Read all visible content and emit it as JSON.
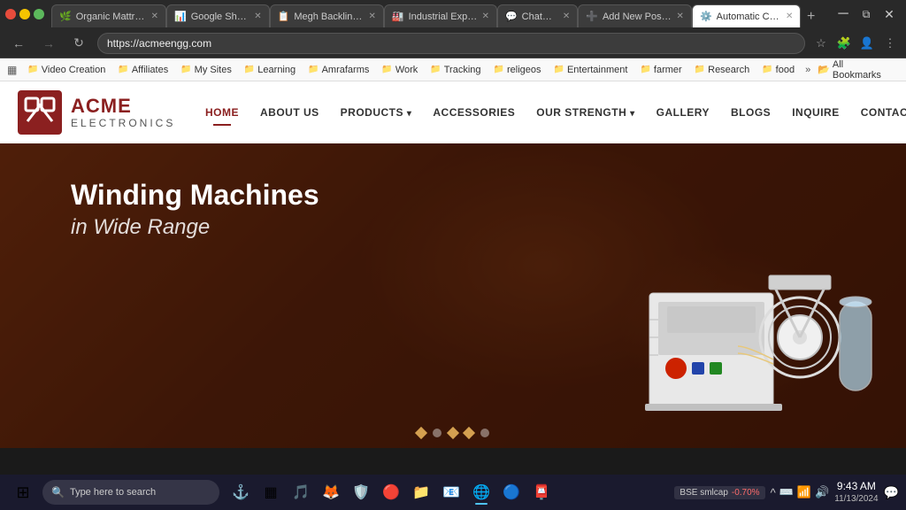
{
  "browser": {
    "title": "Automatic Coil",
    "tabs": [
      {
        "id": "t1",
        "favicon": "🌿",
        "label": "Organic Mattres...",
        "active": false
      },
      {
        "id": "t2",
        "favicon": "📊",
        "label": "Google Sheets",
        "active": false
      },
      {
        "id": "t3",
        "favicon": "📋",
        "label": "Megh Backlinks...",
        "active": false
      },
      {
        "id": "t4",
        "favicon": "🏭",
        "label": "Industrial Exper...",
        "active": false
      },
      {
        "id": "t5",
        "favicon": "💬",
        "label": "ChatGPT",
        "active": false
      },
      {
        "id": "t6",
        "favicon": "➕",
        "label": "Add New Post -...",
        "active": false
      },
      {
        "id": "t7",
        "favicon": "🔧",
        "label": "Automatic Coil...",
        "active": true
      }
    ],
    "address": "https://acmeengg.com",
    "bookmarks": [
      {
        "icon": "🎬",
        "label": "Video Creation"
      },
      {
        "icon": "🔗",
        "label": "Affiliates"
      },
      {
        "icon": "🌐",
        "label": "My Sites"
      },
      {
        "icon": "📚",
        "label": "Learning"
      },
      {
        "icon": "🌾",
        "label": "Amrafarms"
      },
      {
        "icon": "💼",
        "label": "Work"
      },
      {
        "icon": "📍",
        "label": "Tracking"
      },
      {
        "icon": "🙏",
        "label": "religeos"
      },
      {
        "icon": "🎭",
        "label": "Entertainment"
      },
      {
        "icon": "👨‍🌾",
        "label": "farmer"
      },
      {
        "icon": "🔬",
        "label": "Research"
      },
      {
        "icon": "🍽️",
        "label": "food"
      }
    ],
    "all_bookmarks": "All Bookmarks"
  },
  "website": {
    "logo": {
      "name": "ACME",
      "sub": "ELECTRONICS"
    },
    "nav": [
      {
        "label": "HOME",
        "active": true,
        "has_arrow": false
      },
      {
        "label": "ABOUT US",
        "active": false,
        "has_arrow": false
      },
      {
        "label": "PRODUCTS",
        "active": false,
        "has_arrow": true
      },
      {
        "label": "ACCESSORIES",
        "active": false,
        "has_arrow": false
      },
      {
        "label": "OUR STRENGTH",
        "active": false,
        "has_arrow": true
      },
      {
        "label": "GALLERY",
        "active": false,
        "has_arrow": false
      },
      {
        "label": "BLOGS",
        "active": false,
        "has_arrow": false
      },
      {
        "label": "INQUIRE",
        "active": false,
        "has_arrow": false
      },
      {
        "label": "CONTACT US",
        "active": false,
        "has_arrow": false
      }
    ],
    "hero": {
      "title": "Winding Machines",
      "subtitle": "in Wide Range"
    },
    "carousel": {
      "dots": [
        {
          "type": "diamond",
          "active": true
        },
        {
          "type": "circle",
          "active": false
        },
        {
          "type": "diamond",
          "active": true
        },
        {
          "type": "diamond",
          "active": true
        },
        {
          "type": "diamond",
          "active": false
        }
      ]
    }
  },
  "taskbar": {
    "search_placeholder": "Type here to search",
    "apps": [
      {
        "icon": "⊞",
        "name": "windows-icon"
      },
      {
        "icon": "🔍",
        "name": "search-icon"
      },
      {
        "icon": "⚓",
        "name": "ship-icon"
      },
      {
        "icon": "▦",
        "name": "grid-icon"
      },
      {
        "icon": "🎵",
        "name": "spotify-icon"
      },
      {
        "icon": "🦊",
        "name": "firefox-icon"
      },
      {
        "icon": "🛡️",
        "name": "brave-icon"
      },
      {
        "icon": "🔴",
        "name": "opera-icon"
      },
      {
        "icon": "📁",
        "name": "files-icon"
      },
      {
        "icon": "📧",
        "name": "mail-icon"
      },
      {
        "icon": "🌀",
        "name": "edge-icon"
      },
      {
        "icon": "🔵",
        "name": "chrome-icon"
      },
      {
        "icon": "📮",
        "name": "outlook-icon"
      }
    ],
    "stock": {
      "name": "BSE smlcap",
      "value": "-0.70%"
    },
    "time": "9:43 AM",
    "date": "11/13/2024"
  }
}
